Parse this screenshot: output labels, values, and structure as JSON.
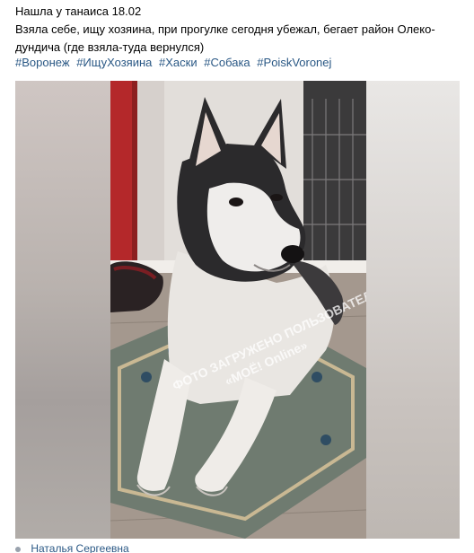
{
  "post": {
    "lines": [
      "Нашла у танаиса 18.02",
      "Взяла себе, ищу хозяина, при прогулке сегодня убежал, бегает район Олеко-",
      "дундича (где взяла-туда вернулся)"
    ],
    "hashtags": [
      "#Воронеж",
      "#ИщуХозяина",
      "#Хаски",
      "#Собака",
      "#PoiskVoronej"
    ],
    "watermark_lines": [
      "ФОТО ЗАГРУЖЕНО ПОЛЬЗОВАТЕЛЕМ",
      "«МОЁ! Online»"
    ],
    "author": "Наталья Сергеевна"
  },
  "colors": {
    "link": "#2a5885",
    "text": "#000000"
  }
}
